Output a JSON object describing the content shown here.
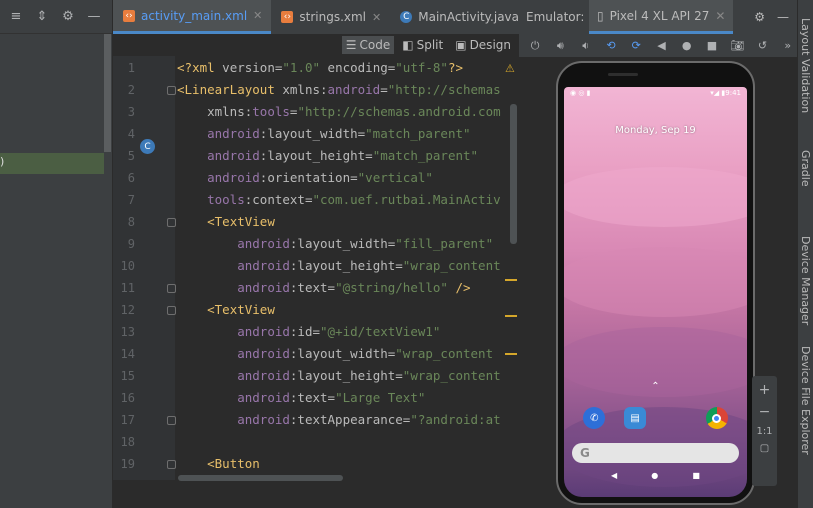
{
  "left_panel": {
    "icons": [
      "align-left-icon",
      "collapse-all-icon",
      "gear-icon",
      "minimize-icon"
    ],
    "highlight_text": ")"
  },
  "tabs": [
    {
      "label": "activity_main.xml",
      "icon": "xml-file-icon",
      "active": true
    },
    {
      "label": "strings.xml",
      "icon": "xml-file-icon",
      "active": false
    },
    {
      "label": "MainActivity.java",
      "icon": "class-file-icon",
      "active": false
    }
  ],
  "modes": {
    "code": "Code",
    "split": "Split",
    "design": "Design"
  },
  "editor": {
    "lines": [
      {
        "n": "1",
        "parts": [
          [
            "brk",
            "<?"
          ],
          [
            "tag",
            "xml "
          ],
          [
            "attr",
            "version="
          ],
          [
            "val",
            "\"1.0\" "
          ],
          [
            "attr",
            "encoding="
          ],
          [
            "val",
            "\"utf-8\""
          ],
          [
            "brk",
            "?>"
          ]
        ]
      },
      {
        "n": "2",
        "parts": [
          [
            "brk",
            "<"
          ],
          [
            "tag",
            "LinearLayout "
          ],
          [
            "attr",
            "xmlns:"
          ],
          [
            "ns",
            "android"
          ],
          [
            "attr",
            "="
          ],
          [
            "val",
            "\"http://schemas"
          ]
        ]
      },
      {
        "n": "3",
        "parts": [
          [
            "txt",
            "    "
          ],
          [
            "attr",
            "xmlns:"
          ],
          [
            "ns",
            "tools"
          ],
          [
            "attr",
            "="
          ],
          [
            "val",
            "\"http://schemas.android.com"
          ]
        ]
      },
      {
        "n": "4",
        "parts": [
          [
            "txt",
            "    "
          ],
          [
            "ns",
            "android"
          ],
          [
            "attr",
            ":layout_width="
          ],
          [
            "val",
            "\"match_parent\""
          ]
        ]
      },
      {
        "n": "5",
        "parts": [
          [
            "txt",
            "    "
          ],
          [
            "ns",
            "android"
          ],
          [
            "attr",
            ":layout_height="
          ],
          [
            "val",
            "\"match_parent\""
          ]
        ]
      },
      {
        "n": "6",
        "parts": [
          [
            "txt",
            "    "
          ],
          [
            "ns",
            "android"
          ],
          [
            "attr",
            ":orientation="
          ],
          [
            "val",
            "\"vertical\""
          ]
        ]
      },
      {
        "n": "7",
        "parts": [
          [
            "txt",
            "    "
          ],
          [
            "ns",
            "tools"
          ],
          [
            "attr",
            ":context="
          ],
          [
            "val",
            "\"com.uef.rutbai.MainActiv"
          ]
        ]
      },
      {
        "n": "8",
        "parts": [
          [
            "txt",
            "    "
          ],
          [
            "brk",
            "<"
          ],
          [
            "tag",
            "TextView"
          ]
        ]
      },
      {
        "n": "9",
        "parts": [
          [
            "txt",
            "        "
          ],
          [
            "ns",
            "android"
          ],
          [
            "attr",
            ":layout_width="
          ],
          [
            "val",
            "\"fill_parent\""
          ]
        ]
      },
      {
        "n": "10",
        "parts": [
          [
            "txt",
            "        "
          ],
          [
            "ns",
            "android"
          ],
          [
            "attr",
            ":layout_height="
          ],
          [
            "val",
            "\"wrap_content"
          ]
        ]
      },
      {
        "n": "11",
        "parts": [
          [
            "txt",
            "        "
          ],
          [
            "ns",
            "android"
          ],
          [
            "attr",
            ":text="
          ],
          [
            "val",
            "\"@string/hello\" "
          ],
          [
            "brk",
            "/>"
          ]
        ]
      },
      {
        "n": "12",
        "parts": [
          [
            "txt",
            "    "
          ],
          [
            "brk",
            "<"
          ],
          [
            "tag",
            "TextView"
          ]
        ]
      },
      {
        "n": "13",
        "parts": [
          [
            "txt",
            "        "
          ],
          [
            "ns",
            "android"
          ],
          [
            "attr",
            ":id="
          ],
          [
            "val",
            "\"@+id/textView1\""
          ]
        ]
      },
      {
        "n": "14",
        "parts": [
          [
            "txt",
            "        "
          ],
          [
            "ns",
            "android"
          ],
          [
            "attr",
            ":layout_width="
          ],
          [
            "val",
            "\"wrap_content"
          ]
        ]
      },
      {
        "n": "15",
        "parts": [
          [
            "txt",
            "        "
          ],
          [
            "ns",
            "android"
          ],
          [
            "attr",
            ":layout_height="
          ],
          [
            "val",
            "\"wrap_content"
          ]
        ]
      },
      {
        "n": "16",
        "parts": [
          [
            "txt",
            "        "
          ],
          [
            "ns",
            "android"
          ],
          [
            "attr",
            ":text="
          ],
          [
            "val",
            "\"Large Text\""
          ]
        ]
      },
      {
        "n": "17",
        "parts": [
          [
            "txt",
            "        "
          ],
          [
            "ns",
            "android"
          ],
          [
            "attr",
            ":textAppearance="
          ],
          [
            "val",
            "\"?android:at"
          ]
        ]
      },
      {
        "n": "18",
        "parts": []
      },
      {
        "n": "19",
        "parts": [
          [
            "txt",
            "    "
          ],
          [
            "brk",
            "<"
          ],
          [
            "tag",
            "Button"
          ]
        ]
      }
    ],
    "gutter_badge": "C",
    "warning": "⚠"
  },
  "emulator": {
    "title": "Emulator:",
    "device_tab": "Pixel 4 XL API 27",
    "toolbar_icons": [
      "power-icon",
      "volume-up-icon",
      "volume-down-icon",
      "rotate-left-icon",
      "rotate-right-icon",
      "back-icon",
      "home-icon",
      "overview-icon",
      "screenshot-icon",
      "snapshot-icon",
      "more-icon"
    ],
    "phone": {
      "date": "Monday, Sep 19",
      "status_left": "◉ ◎ ▮",
      "status_right": "▾◢ ▮9:41",
      "swipe_up": "⌃",
      "google_g": "G"
    },
    "zoom": {
      "plus": "+",
      "minus": "−",
      "one_to_one": "1:1"
    }
  },
  "right_strip": {
    "items": [
      "Layout Validation",
      "Gradle",
      "Device Manager",
      "Device File Explorer"
    ]
  },
  "colors": {
    "accent": "#4a88c7",
    "tag": "#e8bf6a",
    "string": "#6a8759",
    "namespace": "#9876aa"
  }
}
